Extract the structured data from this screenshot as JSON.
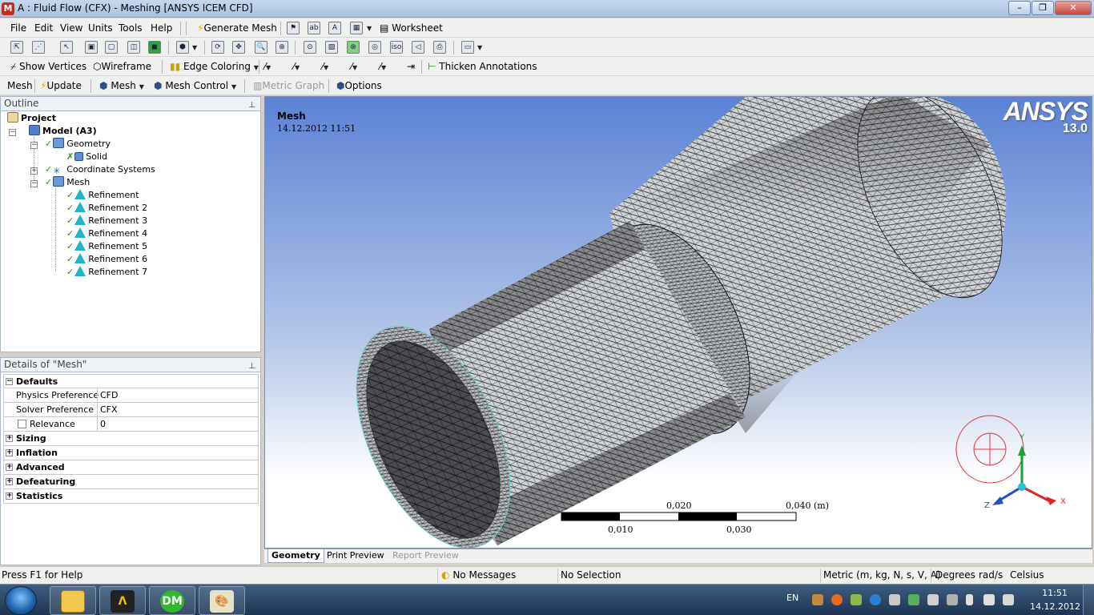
{
  "window": {
    "title": "A : Fluid Flow (CFX) - Meshing [ANSYS ICEM CFD]",
    "app_icon": "M",
    "minimize": "–",
    "maximize": "❐",
    "close": "✕"
  },
  "menu": [
    "File",
    "Edit",
    "View",
    "Units",
    "Tools",
    "Help"
  ],
  "toolbar1": {
    "generate_mesh": "Generate Mesh",
    "worksheet": "Worksheet"
  },
  "toolbar2": {
    "show_vertices": "Show Vertices",
    "wireframe": "Wireframe",
    "edge_coloring": "Edge Coloring",
    "thicken_annotations": "Thicken Annotations"
  },
  "toolbar3": {
    "mesh": "Mesh",
    "update": "Update",
    "mesh_menu": "Mesh",
    "mesh_control": "Mesh Control",
    "metric_graph": "Metric Graph",
    "options": "Options"
  },
  "outline": {
    "title": "Outline",
    "pin": "ᵖ",
    "tree": {
      "project": "Project",
      "model": "Model (A3)",
      "geometry": "Geometry",
      "solid": "Solid",
      "coordinate_systems": "Coordinate Systems",
      "mesh": "Mesh",
      "refinements": [
        "Refinement",
        "Refinement 2",
        "Refinement 3",
        "Refinement 4",
        "Refinement 5",
        "Refinement 6",
        "Refinement 7"
      ]
    }
  },
  "details": {
    "title": "Details of \"Mesh\"",
    "pin": "ᵖ",
    "rows": {
      "defaults": "Defaults",
      "physics_label": "Physics Preference",
      "physics_value": "CFD",
      "solver_label": "Solver Preference",
      "solver_value": "CFX",
      "relevance_label": "Relevance",
      "relevance_value": "0",
      "sizing": "Sizing",
      "inflation": "Inflation",
      "advanced": "Advanced",
      "defeaturing": "Defeaturing",
      "statistics": "Statistics"
    }
  },
  "viewport": {
    "label": "Mesh",
    "date": "14.12.2012 11:51",
    "brand": "ANSYS",
    "version": "13.0",
    "scale": {
      "l0": "0,010",
      "l1": "0,020",
      "l2": "0,030",
      "l3": "0,040 (m)"
    },
    "triad": {
      "x": "X",
      "y": "Y",
      "z": "Z"
    }
  },
  "tabs": [
    "Geometry",
    "Print Preview",
    "Report Preview"
  ],
  "status": {
    "help": "Press F1 for Help",
    "messages": "No Messages",
    "selection": "No Selection",
    "units": "Metric (m, kg, N, s, V, A)",
    "angle": "Degrees",
    "rate": "rad/s",
    "temp": "Celsius"
  },
  "taskbar": {
    "lang": "EN",
    "time": "11:51",
    "date": "14.12.2012",
    "dm": "DM"
  },
  "colors": {
    "refinement_icon": "#1fb6c9",
    "check": "#1e8f1e",
    "viewport_top": "#5a82d6"
  }
}
